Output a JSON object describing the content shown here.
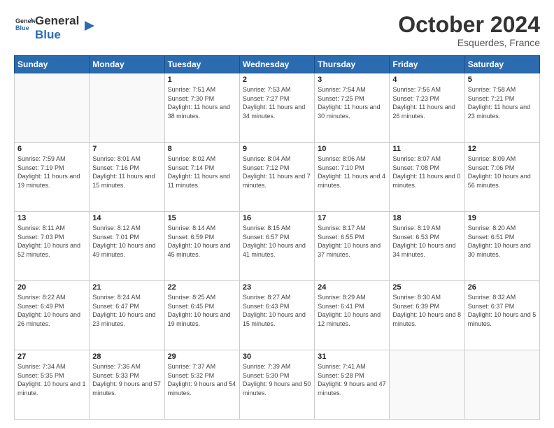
{
  "header": {
    "logo_general": "General",
    "logo_blue": "Blue",
    "month": "October 2024",
    "location": "Esquerdes, France"
  },
  "days_of_week": [
    "Sunday",
    "Monday",
    "Tuesday",
    "Wednesday",
    "Thursday",
    "Friday",
    "Saturday"
  ],
  "weeks": [
    [
      {
        "num": "",
        "sunrise": "",
        "sunset": "",
        "daylight": ""
      },
      {
        "num": "",
        "sunrise": "",
        "sunset": "",
        "daylight": ""
      },
      {
        "num": "1",
        "sunrise": "Sunrise: 7:51 AM",
        "sunset": "Sunset: 7:30 PM",
        "daylight": "Daylight: 11 hours and 38 minutes."
      },
      {
        "num": "2",
        "sunrise": "Sunrise: 7:53 AM",
        "sunset": "Sunset: 7:27 PM",
        "daylight": "Daylight: 11 hours and 34 minutes."
      },
      {
        "num": "3",
        "sunrise": "Sunrise: 7:54 AM",
        "sunset": "Sunset: 7:25 PM",
        "daylight": "Daylight: 11 hours and 30 minutes."
      },
      {
        "num": "4",
        "sunrise": "Sunrise: 7:56 AM",
        "sunset": "Sunset: 7:23 PM",
        "daylight": "Daylight: 11 hours and 26 minutes."
      },
      {
        "num": "5",
        "sunrise": "Sunrise: 7:58 AM",
        "sunset": "Sunset: 7:21 PM",
        "daylight": "Daylight: 11 hours and 23 minutes."
      }
    ],
    [
      {
        "num": "6",
        "sunrise": "Sunrise: 7:59 AM",
        "sunset": "Sunset: 7:19 PM",
        "daylight": "Daylight: 11 hours and 19 minutes."
      },
      {
        "num": "7",
        "sunrise": "Sunrise: 8:01 AM",
        "sunset": "Sunset: 7:16 PM",
        "daylight": "Daylight: 11 hours and 15 minutes."
      },
      {
        "num": "8",
        "sunrise": "Sunrise: 8:02 AM",
        "sunset": "Sunset: 7:14 PM",
        "daylight": "Daylight: 11 hours and 11 minutes."
      },
      {
        "num": "9",
        "sunrise": "Sunrise: 8:04 AM",
        "sunset": "Sunset: 7:12 PM",
        "daylight": "Daylight: 11 hours and 7 minutes."
      },
      {
        "num": "10",
        "sunrise": "Sunrise: 8:06 AM",
        "sunset": "Sunset: 7:10 PM",
        "daylight": "Daylight: 11 hours and 4 minutes."
      },
      {
        "num": "11",
        "sunrise": "Sunrise: 8:07 AM",
        "sunset": "Sunset: 7:08 PM",
        "daylight": "Daylight: 11 hours and 0 minutes."
      },
      {
        "num": "12",
        "sunrise": "Sunrise: 8:09 AM",
        "sunset": "Sunset: 7:06 PM",
        "daylight": "Daylight: 10 hours and 56 minutes."
      }
    ],
    [
      {
        "num": "13",
        "sunrise": "Sunrise: 8:11 AM",
        "sunset": "Sunset: 7:03 PM",
        "daylight": "Daylight: 10 hours and 52 minutes."
      },
      {
        "num": "14",
        "sunrise": "Sunrise: 8:12 AM",
        "sunset": "Sunset: 7:01 PM",
        "daylight": "Daylight: 10 hours and 49 minutes."
      },
      {
        "num": "15",
        "sunrise": "Sunrise: 8:14 AM",
        "sunset": "Sunset: 6:59 PM",
        "daylight": "Daylight: 10 hours and 45 minutes."
      },
      {
        "num": "16",
        "sunrise": "Sunrise: 8:15 AM",
        "sunset": "Sunset: 6:57 PM",
        "daylight": "Daylight: 10 hours and 41 minutes."
      },
      {
        "num": "17",
        "sunrise": "Sunrise: 8:17 AM",
        "sunset": "Sunset: 6:55 PM",
        "daylight": "Daylight: 10 hours and 37 minutes."
      },
      {
        "num": "18",
        "sunrise": "Sunrise: 8:19 AM",
        "sunset": "Sunset: 6:53 PM",
        "daylight": "Daylight: 10 hours and 34 minutes."
      },
      {
        "num": "19",
        "sunrise": "Sunrise: 8:20 AM",
        "sunset": "Sunset: 6:51 PM",
        "daylight": "Daylight: 10 hours and 30 minutes."
      }
    ],
    [
      {
        "num": "20",
        "sunrise": "Sunrise: 8:22 AM",
        "sunset": "Sunset: 6:49 PM",
        "daylight": "Daylight: 10 hours and 26 minutes."
      },
      {
        "num": "21",
        "sunrise": "Sunrise: 8:24 AM",
        "sunset": "Sunset: 6:47 PM",
        "daylight": "Daylight: 10 hours and 23 minutes."
      },
      {
        "num": "22",
        "sunrise": "Sunrise: 8:25 AM",
        "sunset": "Sunset: 6:45 PM",
        "daylight": "Daylight: 10 hours and 19 minutes."
      },
      {
        "num": "23",
        "sunrise": "Sunrise: 8:27 AM",
        "sunset": "Sunset: 6:43 PM",
        "daylight": "Daylight: 10 hours and 15 minutes."
      },
      {
        "num": "24",
        "sunrise": "Sunrise: 8:29 AM",
        "sunset": "Sunset: 6:41 PM",
        "daylight": "Daylight: 10 hours and 12 minutes."
      },
      {
        "num": "25",
        "sunrise": "Sunrise: 8:30 AM",
        "sunset": "Sunset: 6:39 PM",
        "daylight": "Daylight: 10 hours and 8 minutes."
      },
      {
        "num": "26",
        "sunrise": "Sunrise: 8:32 AM",
        "sunset": "Sunset: 6:37 PM",
        "daylight": "Daylight: 10 hours and 5 minutes."
      }
    ],
    [
      {
        "num": "27",
        "sunrise": "Sunrise: 7:34 AM",
        "sunset": "Sunset: 5:35 PM",
        "daylight": "Daylight: 10 hours and 1 minute."
      },
      {
        "num": "28",
        "sunrise": "Sunrise: 7:36 AM",
        "sunset": "Sunset: 5:33 PM",
        "daylight": "Daylight: 9 hours and 57 minutes."
      },
      {
        "num": "29",
        "sunrise": "Sunrise: 7:37 AM",
        "sunset": "Sunset: 5:32 PM",
        "daylight": "Daylight: 9 hours and 54 minutes."
      },
      {
        "num": "30",
        "sunrise": "Sunrise: 7:39 AM",
        "sunset": "Sunset: 5:30 PM",
        "daylight": "Daylight: 9 hours and 50 minutes."
      },
      {
        "num": "31",
        "sunrise": "Sunrise: 7:41 AM",
        "sunset": "Sunset: 5:28 PM",
        "daylight": "Daylight: 9 hours and 47 minutes."
      },
      {
        "num": "",
        "sunrise": "",
        "sunset": "",
        "daylight": ""
      },
      {
        "num": "",
        "sunrise": "",
        "sunset": "",
        "daylight": ""
      }
    ]
  ]
}
